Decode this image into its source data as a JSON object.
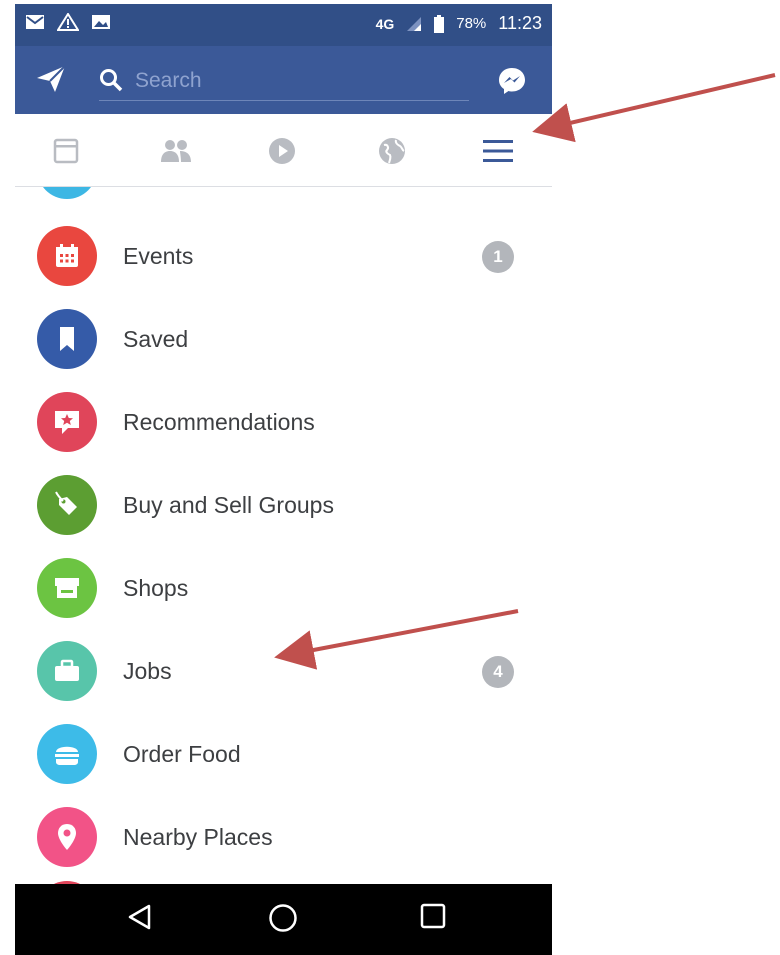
{
  "status_bar": {
    "network": "4G",
    "battery": "78%",
    "time": "11:23"
  },
  "search": {
    "placeholder": "Search"
  },
  "tabs": [
    "news-feed",
    "friends",
    "video",
    "notifications",
    "menu"
  ],
  "menu_items": [
    {
      "label": "Events",
      "icon": "calendar-icon",
      "color": "#e9473f",
      "badge": "1"
    },
    {
      "label": "Saved",
      "icon": "bookmark-icon",
      "color": "#355ba8",
      "badge": ""
    },
    {
      "label": "Recommendations",
      "icon": "star-bubble-icon",
      "color": "#e0455a",
      "badge": ""
    },
    {
      "label": "Buy and Sell Groups",
      "icon": "tag-icon",
      "color": "#5c9e32",
      "badge": ""
    },
    {
      "label": "Shops",
      "icon": "shop-icon",
      "color": "#6cc442",
      "badge": ""
    },
    {
      "label": "Jobs",
      "icon": "briefcase-icon",
      "color": "#58c5aa",
      "badge": "4"
    },
    {
      "label": "Order Food",
      "icon": "burger-icon",
      "color": "#3dbbe8",
      "badge": ""
    },
    {
      "label": "Nearby Places",
      "icon": "location-pin-icon",
      "color": "#f25387",
      "badge": ""
    }
  ],
  "colors": {
    "header": "#3b5998",
    "status": "#314f87",
    "arrow": "#c0504d"
  }
}
